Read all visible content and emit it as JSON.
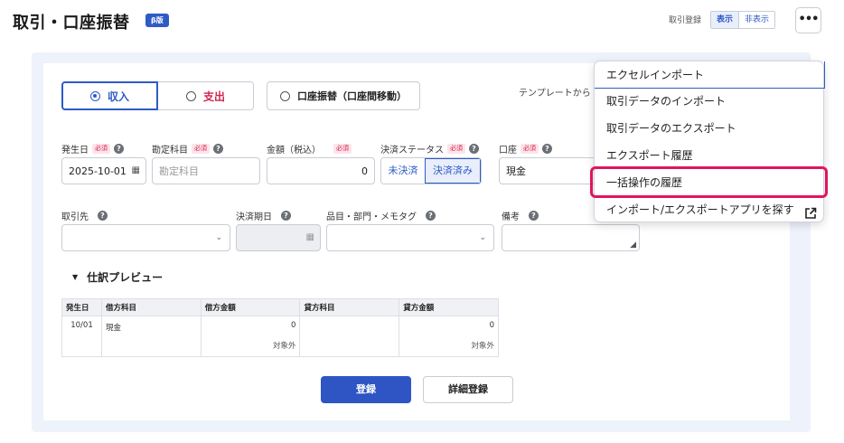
{
  "header": {
    "title": "取引・口座振替",
    "beta_badge": "β版",
    "register_label": "取引登録",
    "toggle_show": "表示",
    "toggle_hide": "非表示",
    "more_icon": "more-horizontal-icon"
  },
  "type_selector": {
    "income": "収入",
    "expense": "支出",
    "transfer": "口座振替（口座間移動）",
    "selected": "収入"
  },
  "template_label": "テンプレートから",
  "form": {
    "date_label": "発生日",
    "date_value": "2025-10-01",
    "account_item_label": "勘定科目",
    "account_item_placeholder": "勘定科目",
    "amount_label": "金額（税込）",
    "amount_value": "0",
    "status_label": "決済ステータス",
    "status_unsettled": "未決済",
    "status_settled": "決済済み",
    "wallet_label": "口座",
    "wallet_value": "現金",
    "partner_label": "取引先",
    "due_date_label": "決済期日",
    "item_label": "品目・部門・メモタグ",
    "memo_label": "備考",
    "required_badge": "必須"
  },
  "preview": {
    "toggle_label": "仕訳プレビュー",
    "headers": [
      "発生日",
      "借方科目",
      "借方金額",
      "貸方科目",
      "貸方金額"
    ],
    "row": {
      "date": "10/01",
      "debit_account": "現金",
      "debit_amount": "0",
      "debit_tax": "対象外",
      "credit_account": "",
      "credit_amount": "0",
      "credit_tax": "対象外"
    }
  },
  "actions": {
    "submit": "登録",
    "detail_submit": "詳細登録"
  },
  "menu": {
    "items": [
      "エクセルインポート",
      "取引データのインポート",
      "取引データのエクスポート",
      "エクスポート履歴",
      "一括操作の履歴",
      "インポート/エクスポートアプリを探す"
    ],
    "highlighted": "一括操作の履歴",
    "external_icon": "external-link-icon"
  },
  "colors": {
    "accent": "#2f5bc7",
    "required": "#d0244c",
    "expense": "#d0244c",
    "highlight": "#e0155f"
  }
}
